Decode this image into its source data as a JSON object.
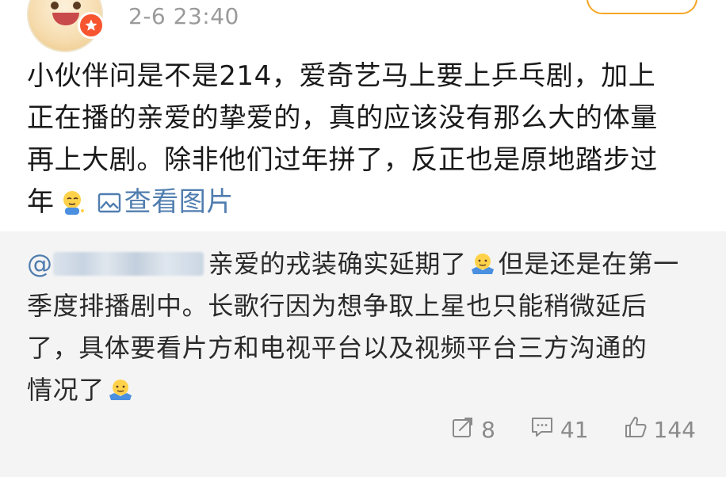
{
  "header": {
    "time": "2-6 23:40"
  },
  "post": {
    "line1": "小伙伴问是不是214，爱奇艺马上要上乒乓剧，加上",
    "line2": "正在播的亲爱的挚爱的，真的应该没有那么大的体量",
    "line3": "再上大剧。除非他们过年拼了，反正也是原地踏步过",
    "line4_text": "年",
    "view_image_label": "查看图片"
  },
  "repost": {
    "mention_prefix": "@",
    "line1_text": "亲爱的戎装确实延期了",
    "line1_tail": "但是还是在第一",
    "line2": "季度排播剧中。长歌行因为想争取上星也只能稍微延后",
    "line3": "了，具体要看片方和电视平台以及视频平台三方沟通的",
    "line4_text": "情况了"
  },
  "actions": {
    "repost_count": "8",
    "comment_count": "41",
    "like_count": "144"
  },
  "colors": {
    "link": "#507daf",
    "meta": "#9a9a9a",
    "repost_bg": "#f4f4f4",
    "badge": "#f7552f"
  },
  "icons": {
    "badge": "star-badge-icon",
    "view_image": "image-icon",
    "repost": "share-icon",
    "comment": "comment-icon",
    "like": "thumbs-up-icon"
  }
}
